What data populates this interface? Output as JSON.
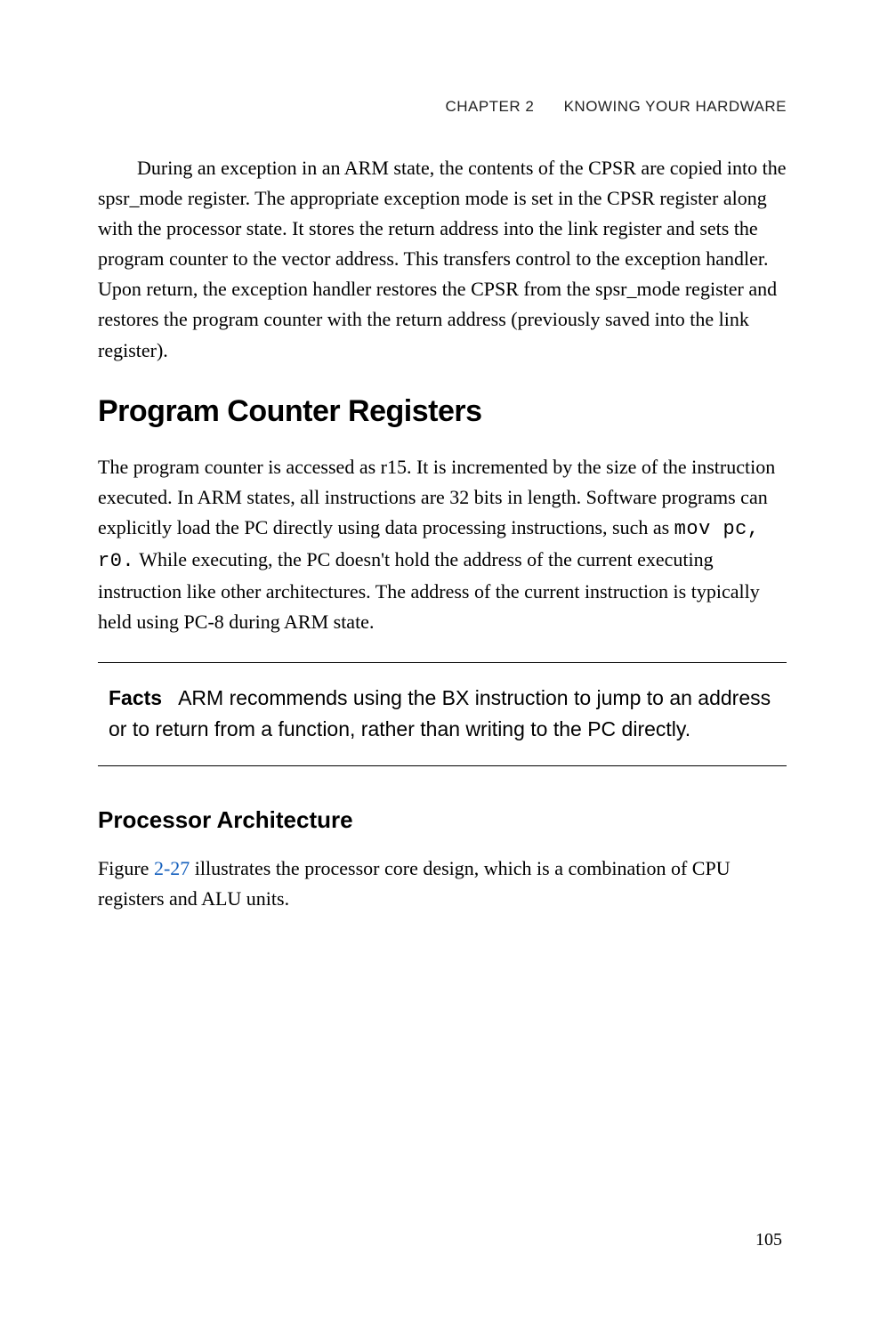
{
  "header": {
    "chapter": "CHAPTER 2",
    "title": "KNOWING YOUR HARDWARE"
  },
  "para1_pre": "During an exception in an ARM state, the contents of the CPSR are copied into the spsr_mode register. The appropriate exception mode is set in the CPSR register along with the processor state. It stores the return address into the link register and sets the program counter to the vector address. This transfers control to the exception handler. Upon return, the exception handler restores the CPSR from the spsr_mode register and restores the program counter with the return address (previously saved into the link register).",
  "section_heading": "Program Counter Registers",
  "para2_a": "The program counter is accessed as r15. It is incremented by the size of the instruction executed. In ARM states, all instructions are 32 bits in length. Software programs can explicitly load the PC directly using data processing instructions, such as ",
  "para2_code": "mov pc, r0.",
  "para2_b": " While executing, the PC doesn't hold the address of the current executing instruction like other architectures. The address of the current instruction is typically held using PC-8 during ARM state.",
  "callout": {
    "label": "Facts",
    "text": "ARM recommends using the BX instruction to jump to an address or to return from a function, rather than writing to the PC directly."
  },
  "subsection_heading": "Processor Architecture",
  "para3_a": "Figure ",
  "para3_link": "2-27",
  "para3_b": " illustrates the processor core design, which is a combination of CPU registers and ALU units.",
  "page_number": "105"
}
